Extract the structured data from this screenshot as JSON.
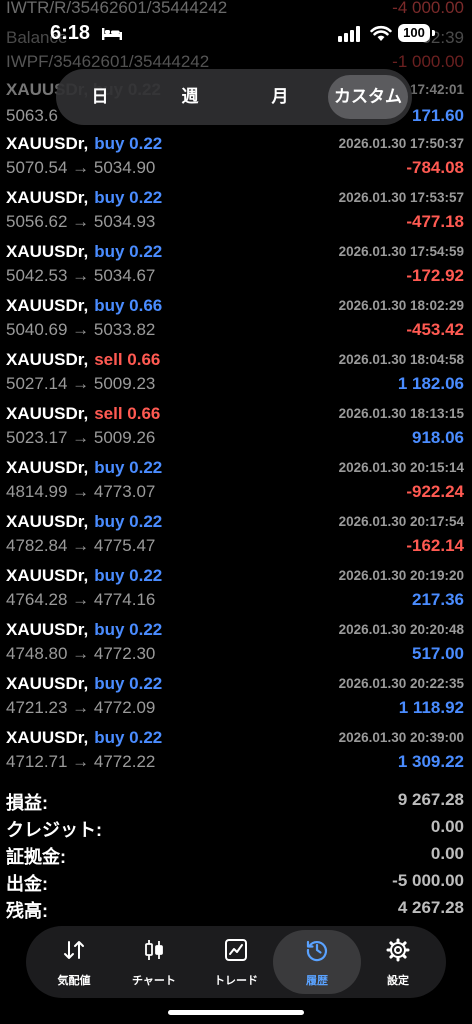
{
  "status_bar": {
    "time": "6:18",
    "battery": "100"
  },
  "ghost_rows": [
    {
      "left": "IWTR/R/35462601/35444242",
      "right": "-4 000.00"
    },
    {
      "left": "Balance",
      "right": "52:39"
    },
    {
      "left": "IWPF/35462601/35444242",
      "right": "-1 000.00"
    },
    {
      "left": "XAUUSDr, buy 0.22",
      "right": "17:42:01"
    },
    {
      "left": "5063.6",
      "right": "171.60"
    }
  ],
  "period_tabs": [
    "日",
    "週",
    "月",
    "カスタム"
  ],
  "trades": [
    {
      "symbol": "XAUUSDr,",
      "side": "buy",
      "lots": "0.22",
      "prices": "5070.54 → 5034.90",
      "datetime": "2026.01.30 17:50:37",
      "profit": "-784.08"
    },
    {
      "symbol": "XAUUSDr,",
      "side": "buy",
      "lots": "0.22",
      "prices": "5056.62 → 5034.93",
      "datetime": "2026.01.30 17:53:57",
      "profit": "-477.18"
    },
    {
      "symbol": "XAUUSDr,",
      "side": "buy",
      "lots": "0.22",
      "prices": "5042.53 → 5034.67",
      "datetime": "2026.01.30 17:54:59",
      "profit": "-172.92"
    },
    {
      "symbol": "XAUUSDr,",
      "side": "buy",
      "lots": "0.66",
      "prices": "5040.69 → 5033.82",
      "datetime": "2026.01.30 18:02:29",
      "profit": "-453.42"
    },
    {
      "symbol": "XAUUSDr,",
      "side": "sell",
      "lots": "0.66",
      "prices": "5027.14 → 5009.23",
      "datetime": "2026.01.30 18:04:58",
      "profit": "1 182.06"
    },
    {
      "symbol": "XAUUSDr,",
      "side": "sell",
      "lots": "0.66",
      "prices": "5023.17 → 5009.26",
      "datetime": "2026.01.30 18:13:15",
      "profit": "918.06"
    },
    {
      "symbol": "XAUUSDr,",
      "side": "buy",
      "lots": "0.22",
      "prices": "4814.99 → 4773.07",
      "datetime": "2026.01.30 20:15:14",
      "profit": "-922.24"
    },
    {
      "symbol": "XAUUSDr,",
      "side": "buy",
      "lots": "0.22",
      "prices": "4782.84 → 4775.47",
      "datetime": "2026.01.30 20:17:54",
      "profit": "-162.14"
    },
    {
      "symbol": "XAUUSDr,",
      "side": "buy",
      "lots": "0.22",
      "prices": "4764.28 → 4774.16",
      "datetime": "2026.01.30 20:19:20",
      "profit": "217.36"
    },
    {
      "symbol": "XAUUSDr,",
      "side": "buy",
      "lots": "0.22",
      "prices": "4748.80 → 4772.30",
      "datetime": "2026.01.30 20:20:48",
      "profit": "517.00"
    },
    {
      "symbol": "XAUUSDr,",
      "side": "buy",
      "lots": "0.22",
      "prices": "4721.23 → 4772.09",
      "datetime": "2026.01.30 20:22:35",
      "profit": "1 118.92"
    },
    {
      "symbol": "XAUUSDr,",
      "side": "buy",
      "lots": "0.22",
      "prices": "4712.71 → 4772.22",
      "datetime": "2026.01.30 20:39:00",
      "profit": "1 309.22"
    }
  ],
  "summary": [
    {
      "label": "損益:",
      "value": "9 267.28"
    },
    {
      "label": "クレジット:",
      "value": "0.00"
    },
    {
      "label": "証拠金:",
      "value": "0.00"
    },
    {
      "label": "出金:",
      "value": "-5 000.00"
    },
    {
      "label": "残高:",
      "value": "4 267.28"
    }
  ],
  "tab_bar": [
    {
      "label": "気配値",
      "icon": "quotes-arrows-icon"
    },
    {
      "label": "チャート",
      "icon": "candlestick-icon"
    },
    {
      "label": "トレード",
      "icon": "trade-chart-icon"
    },
    {
      "label": "履歴",
      "icon": "history-clock-icon"
    },
    {
      "label": "設定",
      "icon": "gear-icon"
    }
  ],
  "colors": {
    "buy": "#4a8cff",
    "sell": "#ff5a52",
    "active_tab": "#5aa2ff",
    "background": "#000000"
  }
}
